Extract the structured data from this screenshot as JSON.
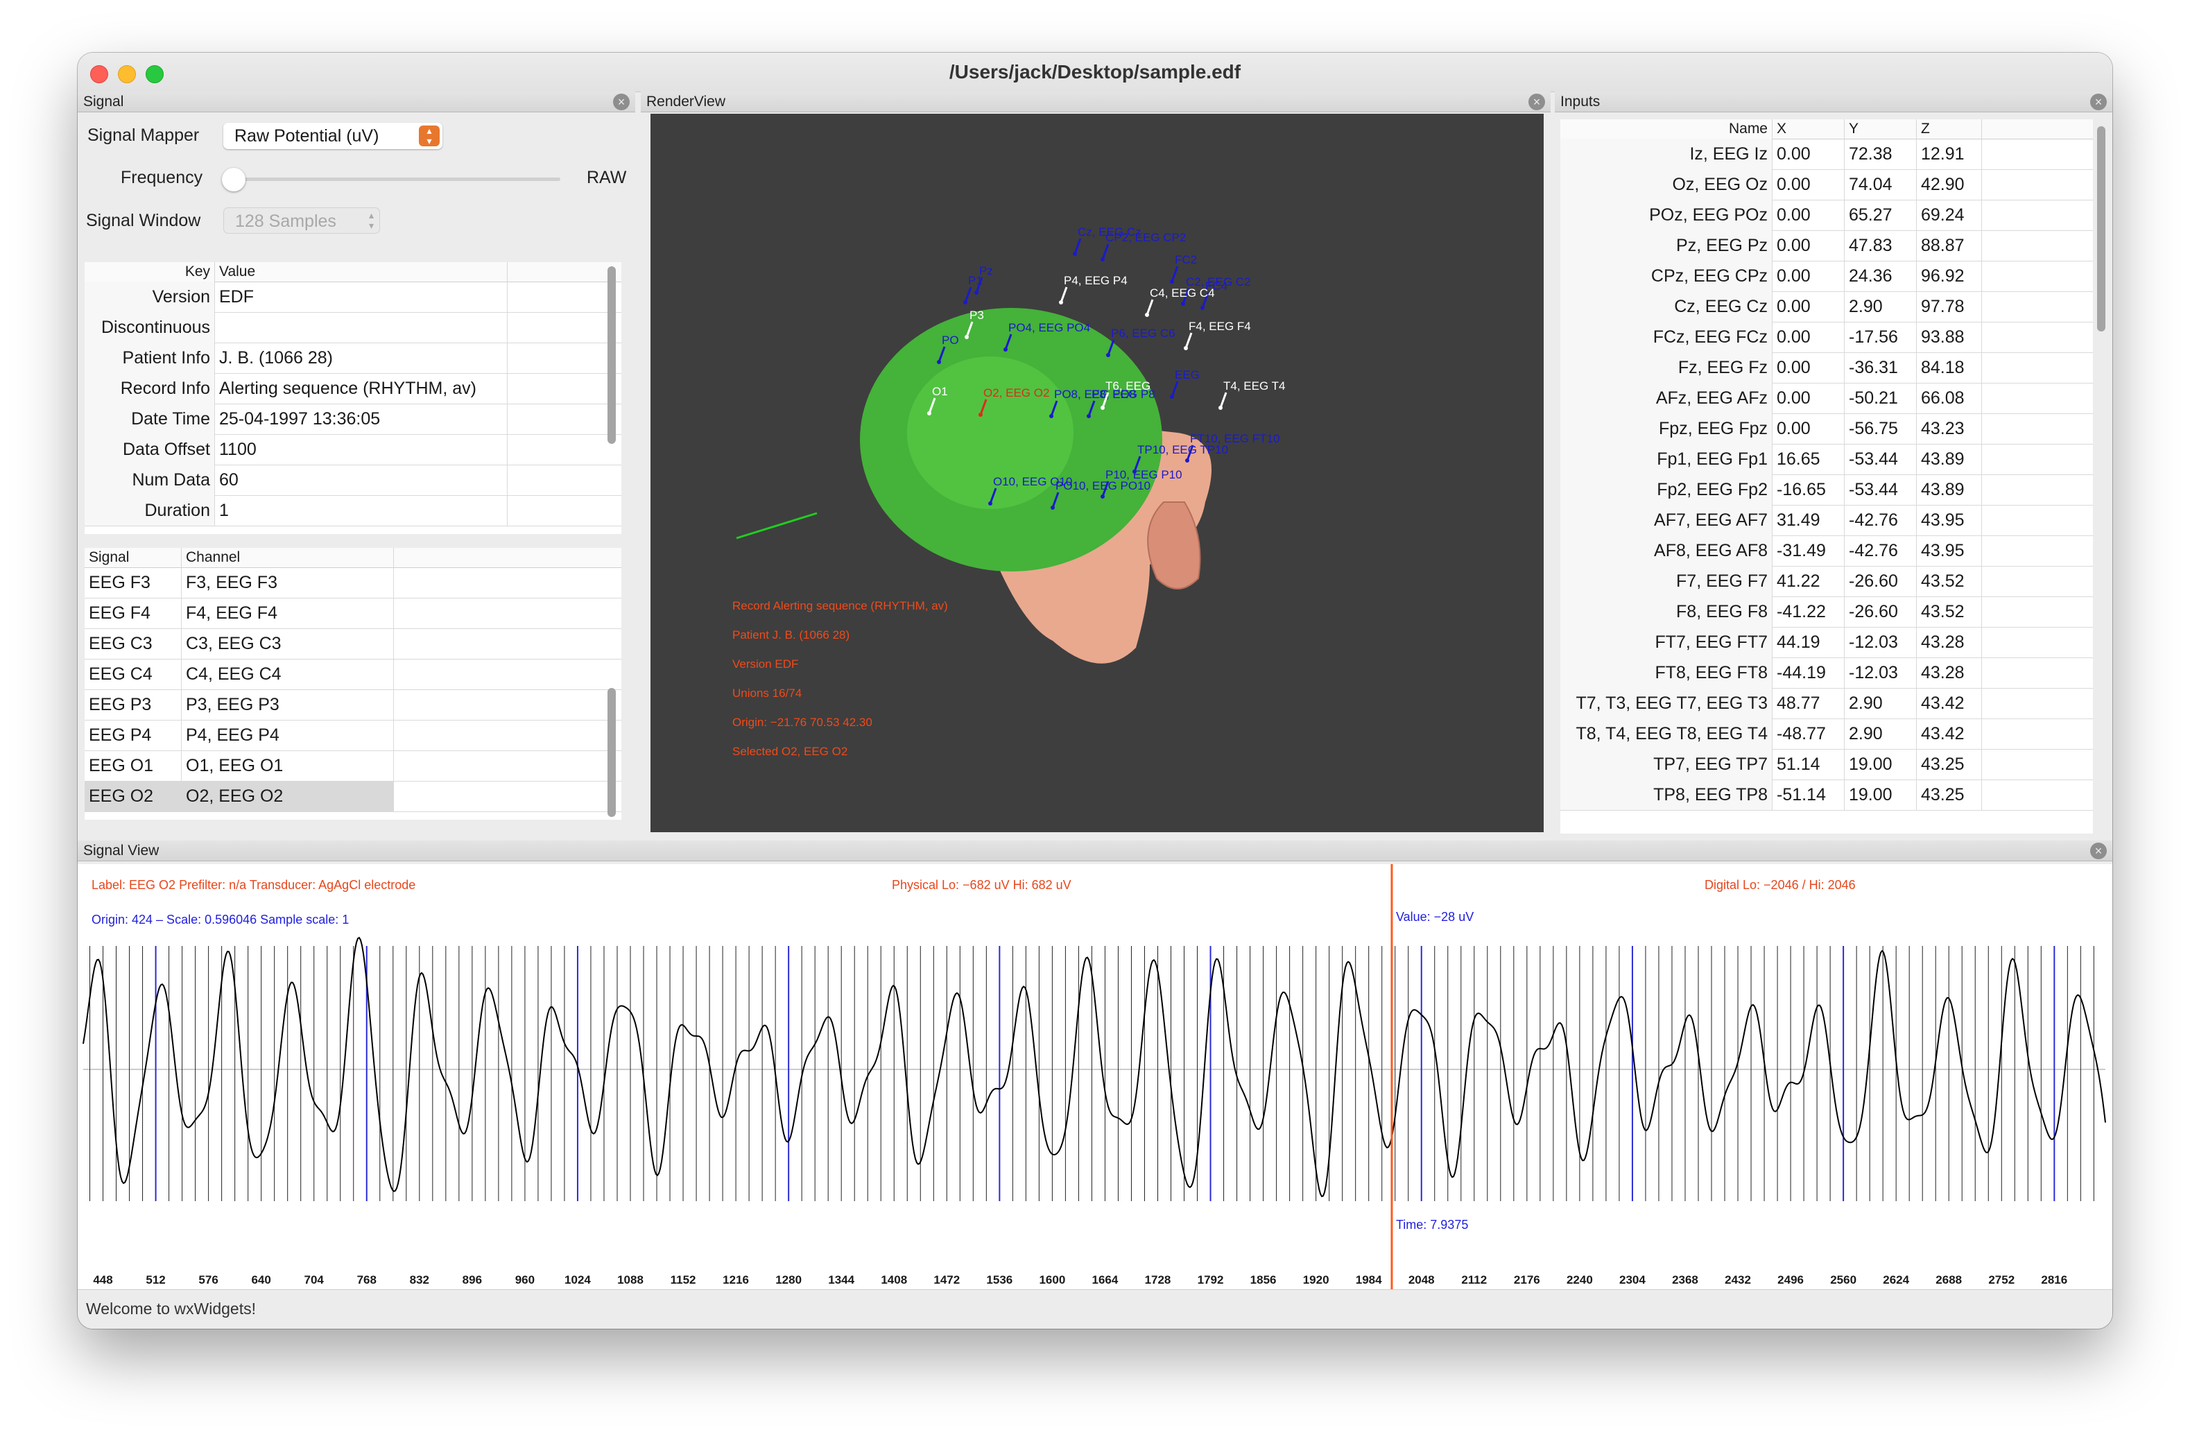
{
  "window": {
    "title": "/Users/jack/Desktop/sample.edf"
  },
  "signal_pane": {
    "title": "Signal",
    "signal_mapper_label": "Signal Mapper",
    "signal_mapper_value": "Raw Potential (uV)",
    "frequency_label": "Frequency",
    "frequency_value_label": "RAW",
    "signal_window_label": "Signal Window",
    "signal_window_value": "128 Samples",
    "info_columns": [
      "Key",
      "Value"
    ],
    "info_rows": [
      {
        "key": "Version",
        "value": "EDF"
      },
      {
        "key": "Discontinuous",
        "value": ""
      },
      {
        "key": "Patient Info",
        "value": "J. B. (1066 28)"
      },
      {
        "key": "Record Info",
        "value": "Alerting sequence (RHYTHM, av)"
      },
      {
        "key": "Date Time",
        "value": "25-04-1997 13:36:05"
      },
      {
        "key": "Data Offset",
        "value": "1100"
      },
      {
        "key": "Num Data",
        "value": "60"
      },
      {
        "key": "Duration",
        "value": "1"
      }
    ],
    "channel_columns": [
      "Signal",
      "Channel"
    ],
    "channel_rows": [
      {
        "signal": "EEG F3",
        "channel": "F3, EEG F3"
      },
      {
        "signal": "EEG F4",
        "channel": "F4, EEG F4"
      },
      {
        "signal": "EEG C3",
        "channel": "C3, EEG C3"
      },
      {
        "signal": "EEG C4",
        "channel": "C4, EEG C4"
      },
      {
        "signal": "EEG P3",
        "channel": "P3, EEG P3"
      },
      {
        "signal": "EEG P4",
        "channel": "P4, EEG P4"
      },
      {
        "signal": "EEG O1",
        "channel": "O1, EEG O1"
      },
      {
        "signal": "EEG O2",
        "channel": "O2, EEG O2"
      }
    ],
    "selected_channel": "EEG O2"
  },
  "render_pane": {
    "title": "RenderView",
    "overlay_lines": [
      "Record Alerting sequence (RHYTHM, av)",
      "Patient J. B. (1066 28)",
      "Version EDF",
      "Unions 16/74",
      "Origin: −21.76 70.53 42.30",
      "Selected O2, EEG O2"
    ],
    "electrodes_white": [
      "P4, EEG P4",
      "C4, EEG C4",
      "F4, EEG F4",
      "P3",
      "O1",
      "T6, EEG",
      "T4, EEG T4"
    ],
    "electrodes_red": [
      "O2, EEG O2"
    ],
    "electrodes_blue": [
      "PO4, EEG PO4",
      "PO8, EEG PO8",
      "P8, EEG P8",
      "O10, EEG O10",
      "PO10, EEG PO10",
      "P10, EEG P10",
      "TP10, EEG TP10",
      "FT10, EEG FT10",
      "C2, EEG C2",
      "Cz, EEG Cz",
      "CP2, EEG CP2",
      "FC4",
      "FC2",
      "P1",
      "Pz",
      "PO",
      "P6, EEG C6",
      "EEG"
    ],
    "colors": {
      "background": "#3e3e3e",
      "scalp": "#45b23a",
      "skin": "#e9a98e",
      "electrode_white": "#ffffff",
      "electrode_red": "#e02a1a",
      "electrode_blue": "#1a1acd"
    }
  },
  "inputs_pane": {
    "title": "Inputs",
    "columns": [
      "Name",
      "X",
      "Y",
      "Z"
    ],
    "rows": [
      {
        "name": "Iz, EEG Iz",
        "x": "0.00",
        "y": "72.38",
        "z": "12.91"
      },
      {
        "name": "Oz, EEG Oz",
        "x": "0.00",
        "y": "74.04",
        "z": "42.90"
      },
      {
        "name": "POz, EEG POz",
        "x": "0.00",
        "y": "65.27",
        "z": "69.24"
      },
      {
        "name": "Pz, EEG Pz",
        "x": "0.00",
        "y": "47.83",
        "z": "88.87"
      },
      {
        "name": "CPz, EEG CPz",
        "x": "0.00",
        "y": "24.36",
        "z": "96.92"
      },
      {
        "name": "Cz, EEG Cz",
        "x": "0.00",
        "y": "2.90",
        "z": "97.78"
      },
      {
        "name": "FCz, EEG FCz",
        "x": "0.00",
        "y": "-17.56",
        "z": "93.88"
      },
      {
        "name": "Fz, EEG Fz",
        "x": "0.00",
        "y": "-36.31",
        "z": "84.18"
      },
      {
        "name": "AFz, EEG AFz",
        "x": "0.00",
        "y": "-50.21",
        "z": "66.08"
      },
      {
        "name": "Fpz, EEG Fpz",
        "x": "0.00",
        "y": "-56.75",
        "z": "43.23"
      },
      {
        "name": "Fp1, EEG Fp1",
        "x": "16.65",
        "y": "-53.44",
        "z": "43.89"
      },
      {
        "name": "Fp2, EEG Fp2",
        "x": "-16.65",
        "y": "-53.44",
        "z": "43.89"
      },
      {
        "name": "AF7, EEG AF7",
        "x": "31.49",
        "y": "-42.76",
        "z": "43.95"
      },
      {
        "name": "AF8, EEG AF8",
        "x": "-31.49",
        "y": "-42.76",
        "z": "43.95"
      },
      {
        "name": "F7, EEG F7",
        "x": "41.22",
        "y": "-26.60",
        "z": "43.52"
      },
      {
        "name": "F8, EEG F8",
        "x": "-41.22",
        "y": "-26.60",
        "z": "43.52"
      },
      {
        "name": "FT7, EEG FT7",
        "x": "44.19",
        "y": "-12.03",
        "z": "43.28"
      },
      {
        "name": "FT8, EEG FT8",
        "x": "-44.19",
        "y": "-12.03",
        "z": "43.28"
      },
      {
        "name": "T7, T3, EEG T7, EEG T3",
        "x": "48.77",
        "y": "2.90",
        "z": "43.42"
      },
      {
        "name": "T8, T4, EEG T8, EEG T4",
        "x": "-48.77",
        "y": "2.90",
        "z": "43.42"
      },
      {
        "name": "TP7, EEG TP7",
        "x": "51.14",
        "y": "19.00",
        "z": "43.25"
      },
      {
        "name": "TP8, EEG TP8",
        "x": "-51.14",
        "y": "19.00",
        "z": "43.25"
      }
    ]
  },
  "signal_view": {
    "title": "Signal View",
    "label_line": "Label: EEG O2 Prefilter: n/a Transducer: AgAgCl electrode",
    "physical_line": "Physical Lo: −682 uV Hi: 682 uV",
    "digital_line": "Digital Lo: −2046 / Hi: 2046",
    "origin_line": "Origin: 424 – Scale: 0.596046 Sample scale: 1",
    "value_line": "Value: −28 uV",
    "time_line": "Time: 7.9375",
    "x_ticks": [
      "448",
      "512",
      "576",
      "640",
      "704",
      "768",
      "832",
      "896",
      "960",
      "1024",
      "1088",
      "1152",
      "1216",
      "1280",
      "1344",
      "1408",
      "1472",
      "1536",
      "1600",
      "1664",
      "1728",
      "1792",
      "1856",
      "1920",
      "1984",
      "2048",
      "2112",
      "2176",
      "2240",
      "2304",
      "2368",
      "2432",
      "2496",
      "2560",
      "2624",
      "2688",
      "2752",
      "2816"
    ],
    "x_range": [
      424,
      2878
    ],
    "cursor_sample": 2012,
    "colors": {
      "label": "#e8461c",
      "info": "#1f1fe0",
      "trace": "#000000",
      "cursor": "#ff5a1f"
    }
  },
  "statusbar": {
    "text": "Welcome to wxWidgets!"
  }
}
